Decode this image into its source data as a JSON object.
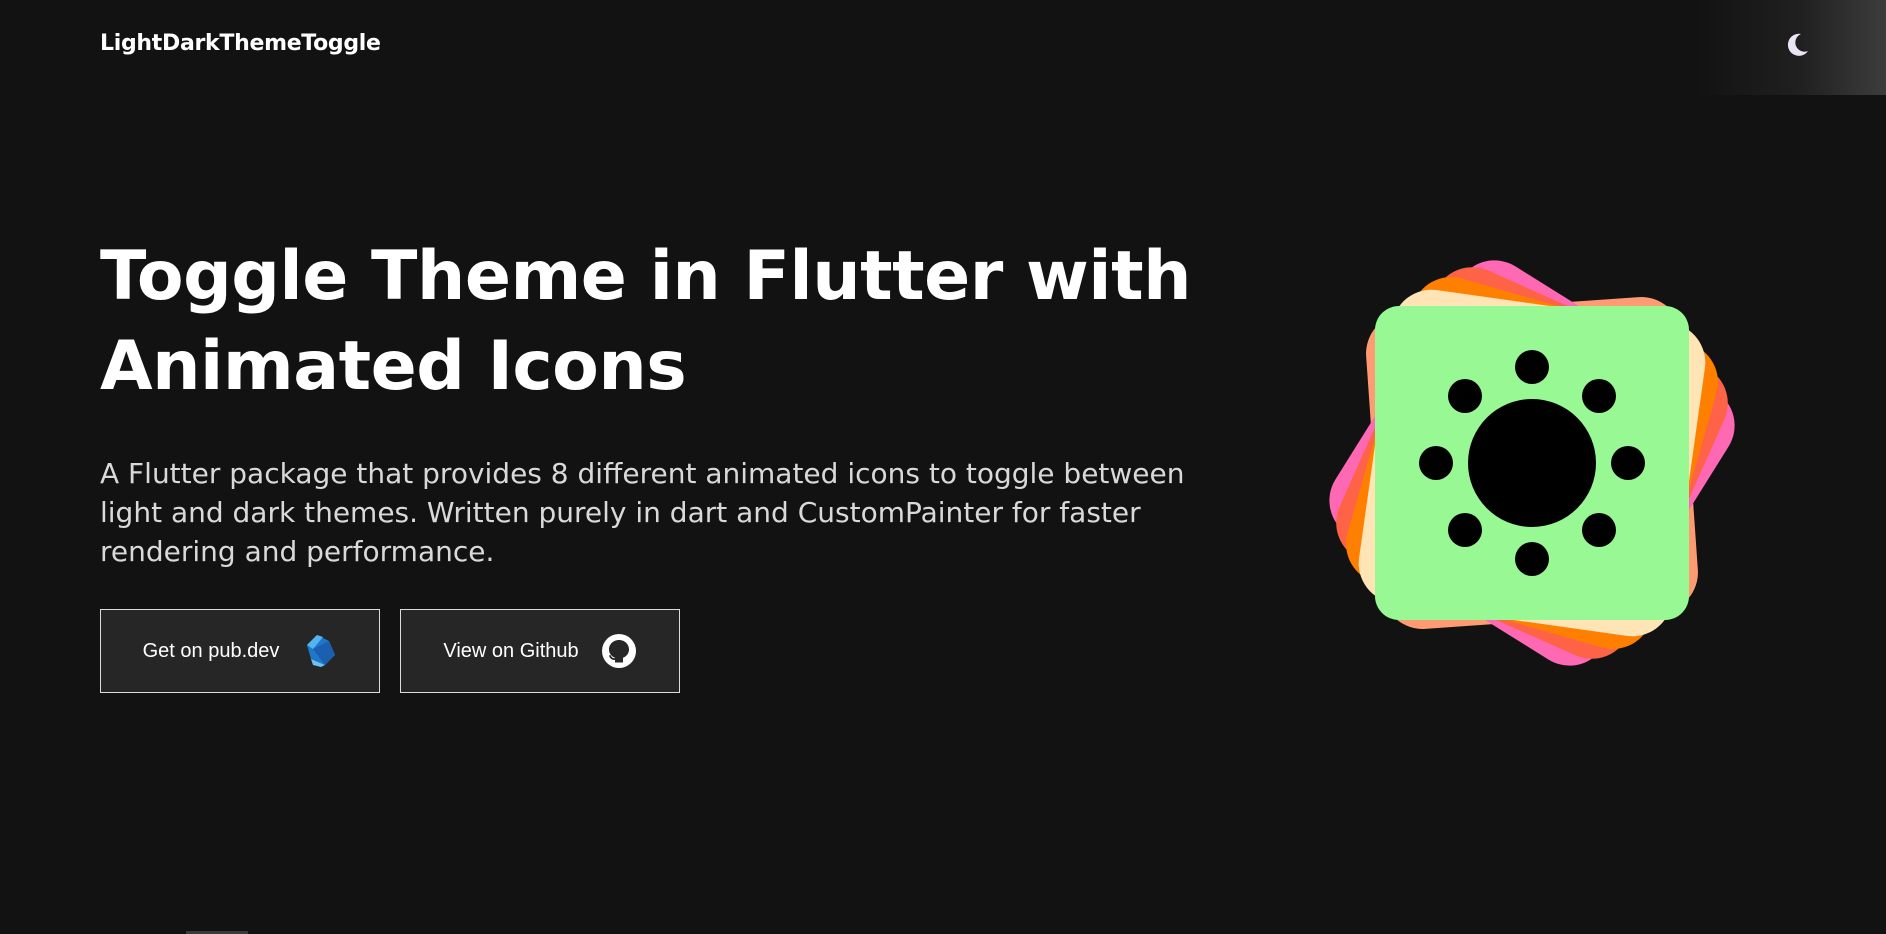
{
  "header": {
    "brand": "LightDarkThemeToggle",
    "theme_toggle_icon": "moon-icon"
  },
  "hero": {
    "title": "Toggle Theme in Flutter with Animated Icons",
    "description": "A Flutter package that provides 8 different animated icons to toggle between light and dark themes. Written purely in dart and CustomPainter for faster rendering and performance."
  },
  "buttons": {
    "pubdev_label": "Get on pub.dev",
    "pubdev_icon": "dart-logo-icon",
    "github_label": "View on Github",
    "github_icon": "github-icon"
  },
  "illustration": {
    "icon": "sun-icon",
    "colors": {
      "tile": "#98f994",
      "petal_colors": [
        "#ff9b73",
        "#ff69b4",
        "#ff6347",
        "#ff8000",
        "#ffe4b5"
      ],
      "sun": "#000000"
    }
  },
  "colors": {
    "background": "#121212",
    "button_bg": "#262626",
    "button_border": "#dcdcdc",
    "text": "#ffffff"
  }
}
